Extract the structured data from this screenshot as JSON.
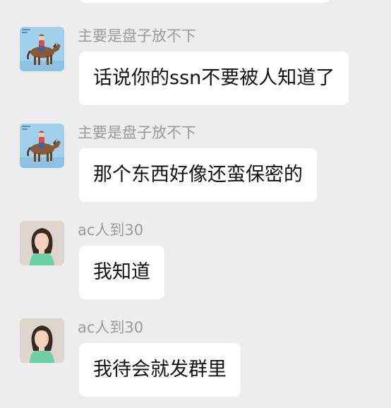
{
  "colors": {
    "background": "#ededed",
    "bubble": "#ffffff",
    "sender_name": "#9a9a9a",
    "message_text": "#111111"
  },
  "messages": [
    {
      "sender": "主要是盘子放不下",
      "avatar_icon": "horse-rider-avatar-icon",
      "text": "话说你的ssn不要被人知道了"
    },
    {
      "sender": "主要是盘子放不下",
      "avatar_icon": "horse-rider-avatar-icon",
      "text": "那个东西好像还蛮保密的"
    },
    {
      "sender": "ac人到30",
      "avatar_icon": "woman-portrait-avatar-icon",
      "text": "我知道"
    },
    {
      "sender": "ac人到30",
      "avatar_icon": "woman-portrait-avatar-icon",
      "text": "我待会就发群里"
    }
  ]
}
